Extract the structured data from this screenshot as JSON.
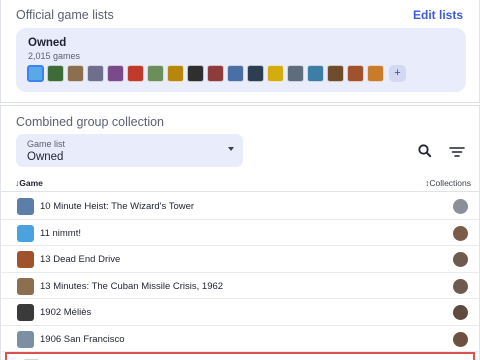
{
  "official": {
    "title": "Official game lists",
    "edit_label": "Edit lists",
    "owned": {
      "title": "Owned",
      "count": "2,015 games",
      "more_symbol": "+"
    },
    "thumb_colors": [
      "#5aa9e6",
      "#3e6b3a",
      "#8b6f4e",
      "#6d6f8c",
      "#7a4a8a",
      "#c0392b",
      "#6b8e5a",
      "#b8860b",
      "#2f2f2f",
      "#8e3b3b",
      "#4a6fa5",
      "#2c3e50",
      "#d4ac0d",
      "#5d6d7e",
      "#3d7ea6",
      "#6e4b2a",
      "#a0522d",
      "#c97b2a"
    ]
  },
  "combined": {
    "title": "Combined group collection",
    "select_label": "Game list",
    "select_value": "Owned",
    "col_game": "↓Game",
    "col_collections": "↕Collections"
  },
  "games": [
    {
      "name": "10 Minute Heist: The Wizard's Tower",
      "thumb": "#5b7fa8",
      "avatar": "#8a8f98"
    },
    {
      "name": "11 nimmt!",
      "thumb": "#4aa3df",
      "avatar": "#7a5c48"
    },
    {
      "name": "13 Dead End Drive",
      "thumb": "#a0522d",
      "avatar": "#6e5a4e"
    },
    {
      "name": "13 Minutes: The Cuban Missile Crisis, 1962",
      "thumb": "#8b6f4e",
      "avatar": "#6e5a4e"
    },
    {
      "name": "1902 Méliès",
      "thumb": "#3a3a3a",
      "avatar": "#5e4a3e"
    },
    {
      "name": "1906 San Francisco",
      "thumb": "#7d8fa3",
      "avatar": "#6e5040"
    },
    {
      "name": "",
      "thumb": "#cfd3da",
      "avatar": "#cfd3da"
    }
  ]
}
